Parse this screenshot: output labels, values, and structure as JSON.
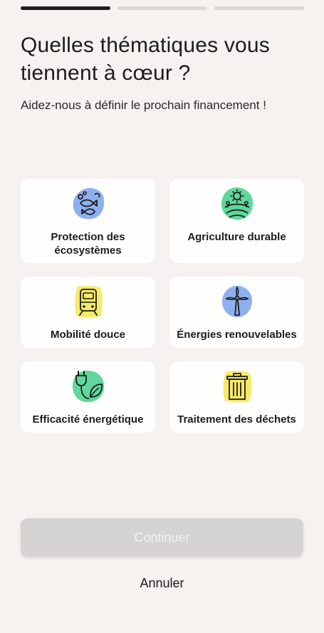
{
  "progress": {
    "total_steps": 3,
    "current_step": 1
  },
  "header": {
    "title": "Quelles thématiques vous tiennent à cœur ?",
    "subtitle": "Aidez-nous à définir le prochain financement !"
  },
  "themes": [
    {
      "label": "Protection des écosystèmes",
      "icon": "fish-ecosystem-icon",
      "blob_color": "#8fb0ef"
    },
    {
      "label": "Agriculture durable",
      "icon": "sun-field-icon",
      "blob_color": "#5fd79b"
    },
    {
      "label": "Mobilité douce",
      "icon": "train-icon",
      "blob_color": "#f7ea67"
    },
    {
      "label": "Énergies renouvelables",
      "icon": "wind-turbine-icon",
      "blob_color": "#8fb0ef"
    },
    {
      "label": "Efficacité énergétique",
      "icon": "plug-leaf-icon",
      "blob_color": "#5fd79b"
    },
    {
      "label": "Traitement des déchets",
      "icon": "trash-bin-icon",
      "blob_color": "#f7ea67"
    }
  ],
  "actions": {
    "continue_label": "Continuer",
    "cancel_label": "Annuler"
  },
  "colors": {
    "background": "#f5f2ef",
    "card": "#fefefd",
    "progress_active": "#1d1d1d",
    "progress_inactive": "#dcd8d4",
    "button_disabled": "#d6d4d2"
  }
}
